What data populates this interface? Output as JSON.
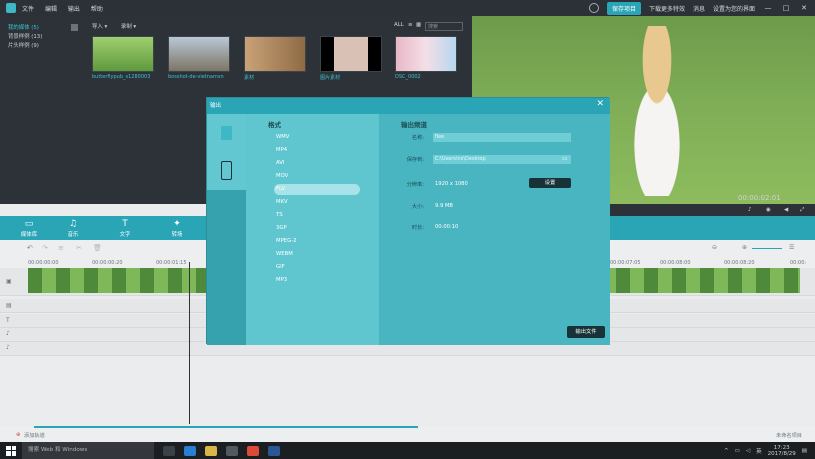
{
  "titlebar": {
    "menu": [
      "文件",
      "编辑",
      "输出",
      "帮助"
    ],
    "save_btn": "保存项目",
    "download_btn": "下载更多特效",
    "messages": "消息",
    "settings": "设置为您的界面"
  },
  "library": {
    "sidebar": [
      "我的媒体 (5)",
      "背景样例 (13)",
      "片头样例 (9)"
    ],
    "import_label": "导入 ▾",
    "record_label": "录制 ▾",
    "all_label": "ALL",
    "search_placeholder": "搜索",
    "items": [
      "butterflypub_s1280003",
      "bosshot-de-vietnamsn",
      "素材",
      "图片素材",
      "DSC_0002"
    ]
  },
  "preview": {
    "time": "00:00:02:01"
  },
  "tabs": [
    "媒体库",
    "音乐",
    "文字",
    "转场"
  ],
  "timeline": {
    "ruler": [
      "00:00:00:00",
      "00:00:00:20",
      "00:00:01:15",
      "00:00:07:05",
      "00:00:08:00",
      "00:00:08:20",
      "00:00:"
    ],
    "bottom_left": "添加轨道",
    "bottom_right": "未命名项目"
  },
  "dialog": {
    "title": "输出",
    "formats_heading": "格式",
    "formats": [
      "WMV",
      "MP4",
      "AVI",
      "MOV",
      "FLV",
      "MKV",
      "TS",
      "3GP",
      "MPEG-2",
      "WEBM",
      "GIF",
      "MP3"
    ],
    "selected_format": "FLV",
    "details_heading": "输出频道",
    "name_label": "名称:",
    "name_value": "flee",
    "save_label": "保存到:",
    "save_value": "C:\\Users\\ns\\Desktop",
    "res_label": "分辨率:",
    "res_value": "1920 x 1080",
    "settings_btn": "设置",
    "size_label": "大小:",
    "size_value": "9.9 MB",
    "duration_label": "时长:",
    "duration_value": "00:00:10",
    "export_btn": "输出文件"
  },
  "taskbar": {
    "search": "搜索 Web 和 Windows",
    "ime": "英",
    "time": "17:23",
    "date": "2017/8/29"
  }
}
